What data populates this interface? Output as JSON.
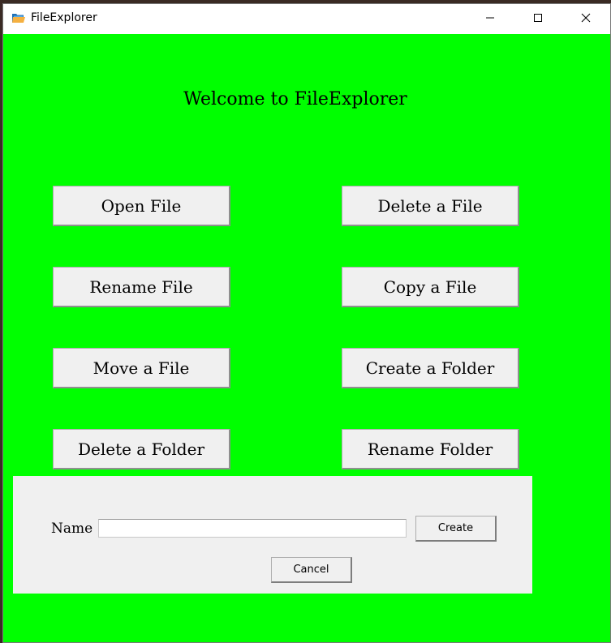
{
  "window": {
    "title": "FileExplorer",
    "icon": "folder-icon",
    "controls": {
      "minimize_icon": "minimize-icon",
      "maximize_icon": "maximize-icon",
      "close_icon": "close-icon"
    }
  },
  "main": {
    "background_color": "#00ff00",
    "welcome": "Welcome to FileExplorer",
    "buttons": {
      "open_file": "Open File",
      "delete_file": "Delete a File",
      "rename_file": "Rename File",
      "copy_file": "Copy a File",
      "move_file": "Move a File",
      "create_folder": "Create a Folder",
      "delete_folder": "Delete a Folder",
      "rename_folder": "Rename Folder"
    }
  },
  "dialog": {
    "name_label": "Name",
    "name_value": "",
    "create_label": "Create",
    "cancel_label": "Cancel"
  }
}
